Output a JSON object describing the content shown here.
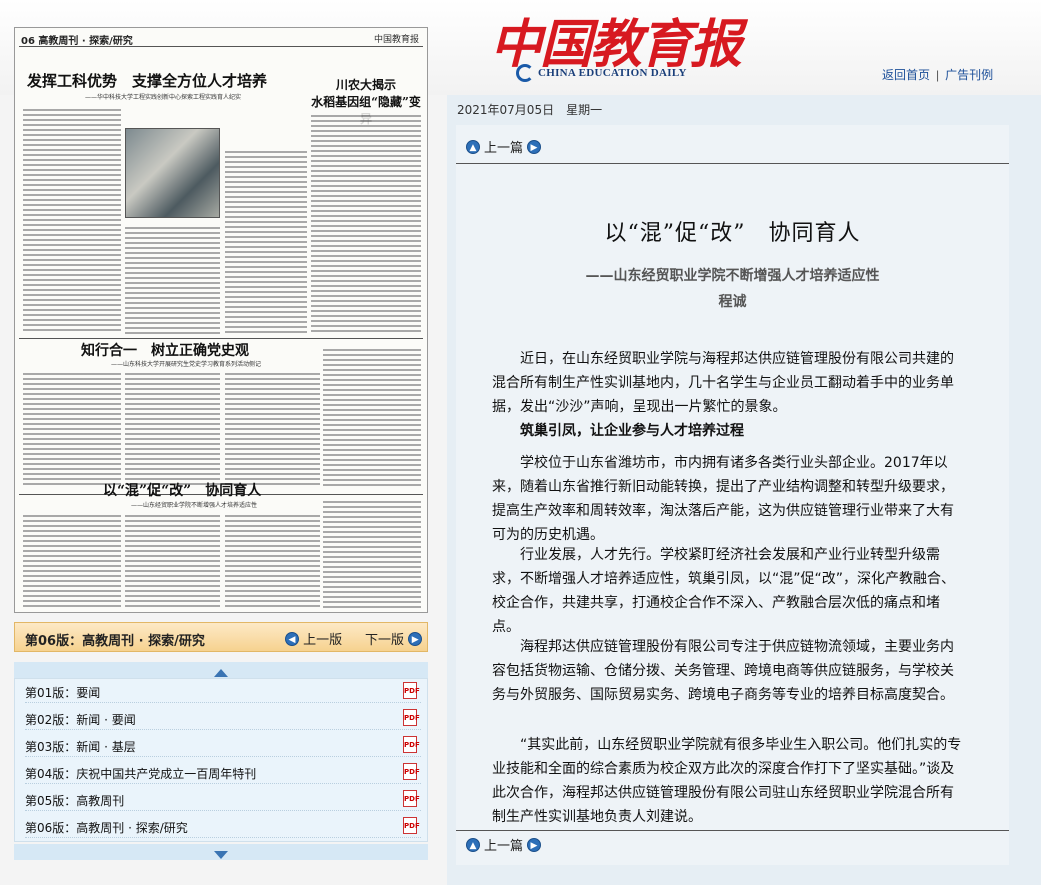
{
  "header": {
    "logo_cn": "中国教育报",
    "logo_en": "CHINA EDUCATION DAILY",
    "links": [
      "返回首页",
      "广告刊例"
    ]
  },
  "newspaper": {
    "masthead": "06 高教周刊 · 探索/研究",
    "masthead_right": "中国教育报",
    "headline1": "发挥工科优势　支撑全方位人才培养",
    "sub1": "——华中科技大学工程实践创新中心探索工程实践育人纪实",
    "side_title": "川农大揭示\n水稻基因组“隐藏”变异",
    "headline2": "知行合一　树立正确党史观",
    "sub2": "——山东科技大学开展研究生党史学习教育系列活动侧记",
    "headline3": "以“混”促“改”　协同育人",
    "sub3": "——山东经贸职业学院不断增强人才培养适应性"
  },
  "page_bar": {
    "current": "第06版：高教周刊 · 探索/研究",
    "prev": "上一版",
    "next": "下一版"
  },
  "page_list": [
    {
      "label": "第01版：要闻"
    },
    {
      "label": "第02版：新闻 · 要闻"
    },
    {
      "label": "第03版：新闻 · 基层"
    },
    {
      "label": "第04版：庆祝中国共产党成立一百周年特刊"
    },
    {
      "label": "第05版：高教周刊"
    },
    {
      "label": "第06版：高教周刊 · 探索/研究"
    }
  ],
  "date_line": "2021年07月05日　星期一",
  "article": {
    "prev_label": "上一篇",
    "title": "以“混”促“改”　协同育人",
    "subtitle": "——山东经贸职业学院不断增强人才培养适应性",
    "author": "程诚",
    "paragraphs": [
      {
        "text": "近日，在山东经贸职业学院与海程邦达供应链管理股份有限公司共建的混合所有制生产性实训基地内，几十名学生与企业员工翻动着手中的业务单据，发出“沙沙”声响，呈现出一片繁忙的景象。",
        "heading": false
      },
      {
        "text": "筑巢引凤，让企业参与人才培养过程",
        "heading": true
      },
      {
        "text": "学校位于山东省潍坊市，市内拥有诸多各类行业头部企业。2017年以来，随着山东省推行新旧动能转换，提出了产业结构调整和转型升级要求，提高生产效率和周转效率，淘汰落后产能，这为供应链管理行业带来了大有可为的历史机遇。",
        "heading": false
      },
      {
        "text": "行业发展，人才先行。学校紧盯经济社会发展和产业行业转型升级需求，不断增强人才培养适应性，筑巢引凤，以“混”促“改”，深化产教融合、校企合作，共建共享，打通校企合作不深入、产教融合层次低的痛点和堵点。",
        "heading": false
      },
      {
        "text": "海程邦达供应链管理股份有限公司专注于供应链物流领域，主要业务内容包括货物运输、仓储分拨、关务管理、跨境电商等供应链服务，与学校关务与外贸服务、国际贸易实务、跨境电子商务等专业的培养目标高度契合。",
        "heading": false
      },
      {
        "text": "“其实此前，山东经贸职业学院就有很多毕业生入职公司。他们扎实的专业技能和全面的综合素质为校企双方此次的深度合作打下了坚实基础。”谈及此次合作，海程邦达供应链管理股份有限公司驻山东经贸职业学院混合所有制生产性实训基地负责人刘建说。",
        "heading": false
      }
    ],
    "bottom_prev_label": "上一篇"
  },
  "colors": {
    "logo_red": "#d71920",
    "link_blue": "#1c4f99",
    "page_bar": "#f6d28f",
    "list_bg": "#eaf4fb",
    "article_bg": "#eef3f7"
  }
}
